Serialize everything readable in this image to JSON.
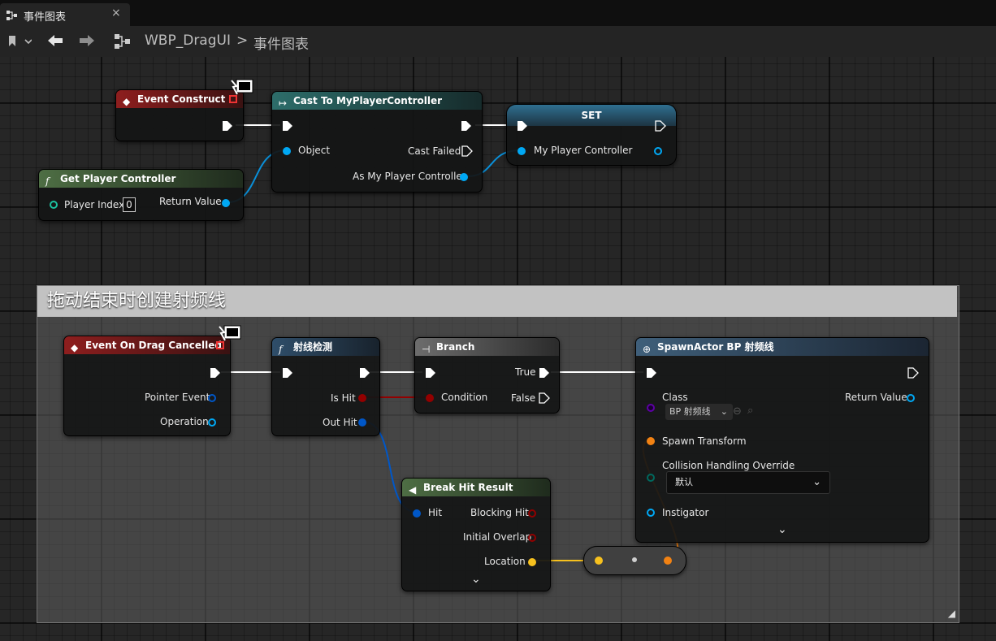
{
  "tab": {
    "icon": "graph-icon",
    "title": "事件图表",
    "close": "×"
  },
  "toolbar": {
    "bookmark_icon": "bookmark-icon",
    "back_icon": "back-arrow-icon",
    "forward_icon": "forward-arrow-icon",
    "graph_icon": "graph-icon",
    "breadcrumb": [
      "WBP_DragUI",
      "事件图表"
    ],
    "separator": ">"
  },
  "comment": {
    "title": "拖动结束时创建射频线"
  },
  "nodes": {
    "event_construct": {
      "title": "Event Construct"
    },
    "cast": {
      "title": "Cast To MyPlayerController",
      "object": "Object",
      "cast_failed": "Cast Failed",
      "as_pc": "As My Player Controller"
    },
    "set": {
      "title": "SET",
      "var": "My Player Controller"
    },
    "get_pc": {
      "title": "Get Player Controller",
      "player_index": "Player Index",
      "player_index_value": "0",
      "return_value": "Return Value"
    },
    "drag_cancelled": {
      "title": "Event On Drag Cancelled",
      "pointer_event": "Pointer Event",
      "operation": "Operation"
    },
    "trace": {
      "title": "射线检测",
      "is_hit": "Is Hit",
      "out_hit": "Out Hit"
    },
    "branch": {
      "title": "Branch",
      "condition": "Condition",
      "true": "True",
      "false": "False"
    },
    "spawn": {
      "title": "SpawnActor BP 射频线",
      "class": "Class",
      "class_value": "BP 射频线",
      "return_value": "Return Value",
      "spawn_transform": "Spawn Transform",
      "collision": "Collision Handling Override",
      "collision_value": "默认",
      "instigator": "Instigator"
    },
    "break_hit": {
      "title": "Break Hit Result",
      "hit": "Hit",
      "blocking_hit": "Blocking Hit",
      "initial_overlap": "Initial Overlap",
      "location": "Location"
    }
  },
  "colors": {
    "exec": "#ffffff",
    "object": "#00a8f4",
    "struct_hit": "#0057c8",
    "bool": "#930000",
    "vector": "#f7c11e",
    "transform": "#f28213",
    "class": "#5e00a6",
    "byte": "#00695f"
  }
}
